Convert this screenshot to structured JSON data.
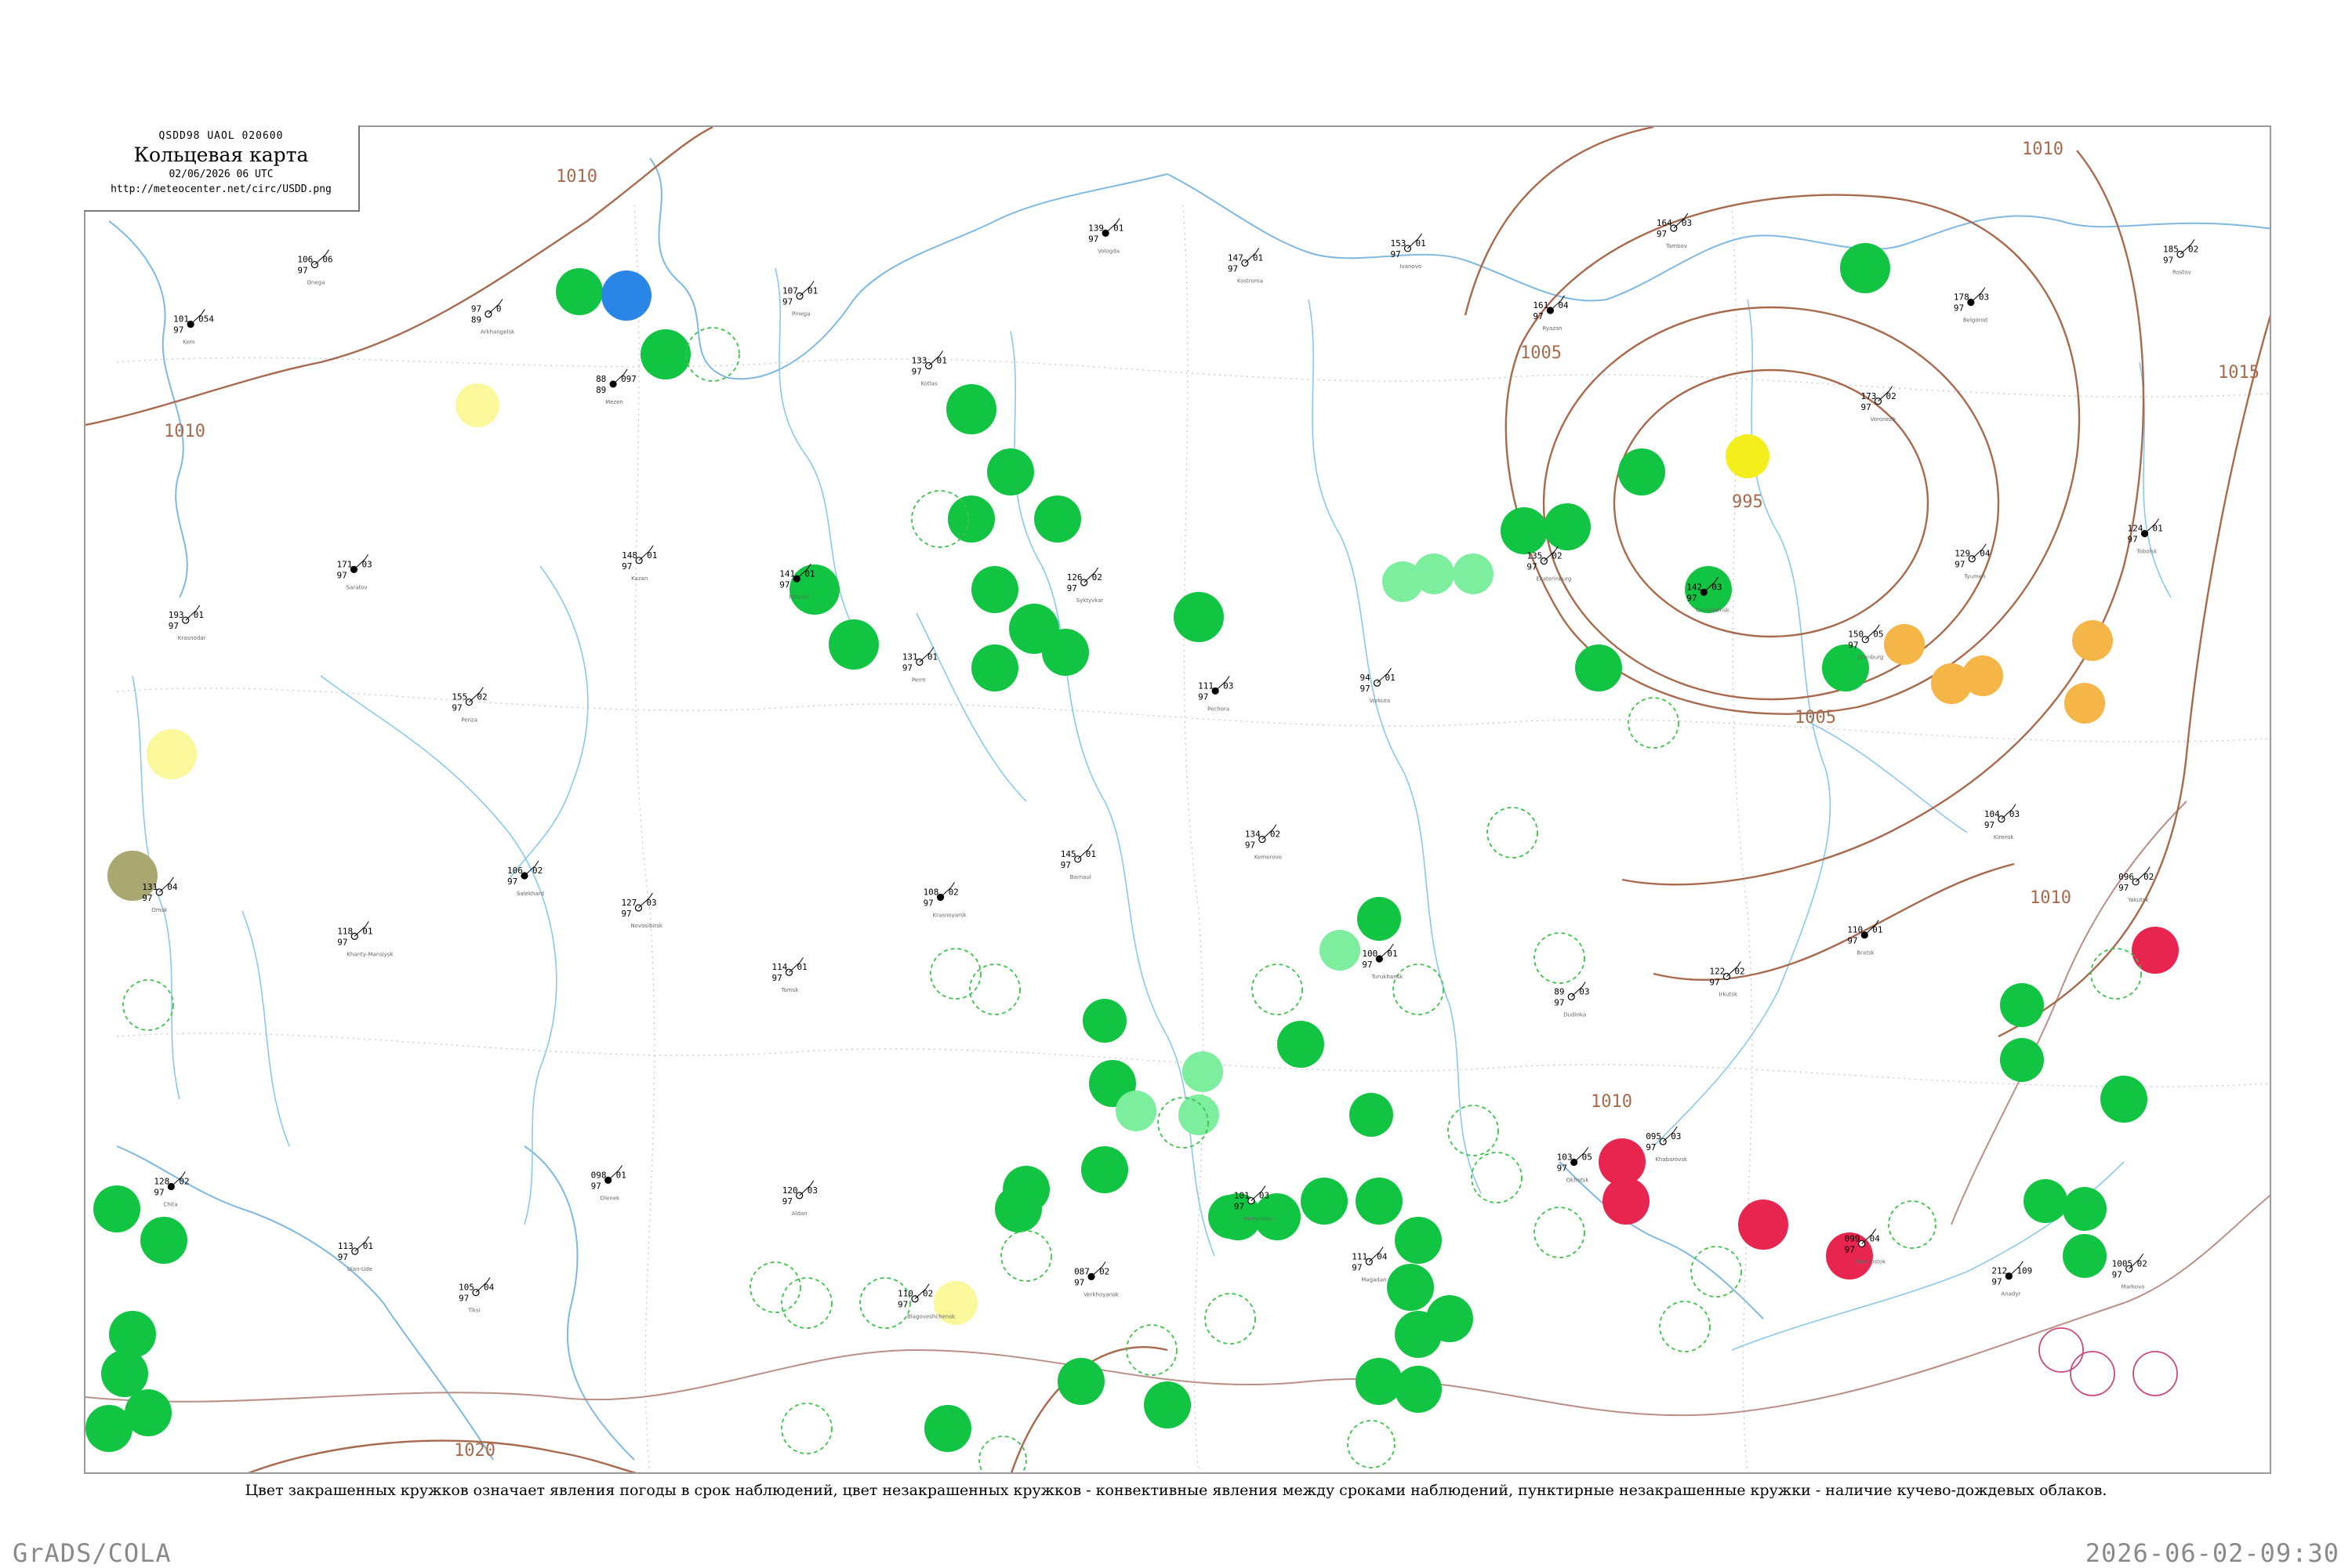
{
  "title_box": {
    "code": "QSDD98  UAOL  020600",
    "title": "Кольцевая карта",
    "date": "02/06/2026 06 UTC",
    "url": "http://meteocenter.net/circ/USDD.png"
  },
  "caption": "Цвет закрашенных кружков означает явления погоды в срок наблюдений, цвет незакрашенных кружков - конвективные явления между сроками наблюдений, пунктирные незакрашенные кружки - наличие кучево-дождевых облаков.",
  "footer": {
    "left": "GrADS/COLA",
    "right": "2026-06-02-09:30"
  },
  "colors": {
    "rain": "#11c442",
    "rain_light": "#7ded9e",
    "snow_shower": "#2a86e6",
    "fog_haze": "#fbf79b",
    "fog_dense": "#f4ee1d",
    "dust": "#a8a870",
    "thunder_shower": "#f5b547",
    "thunderstorm": "#e8254e",
    "cb_dashed": "#3fc24c",
    "convective_ring": "#c94a7a",
    "isobar": "#a86a4e",
    "river": "#8cc8ec"
  },
  "isobar_labels": [
    {
      "text": "1010"
    },
    {
      "text": "1010"
    },
    {
      "text": "1010"
    },
    {
      "text": "1005"
    },
    {
      "text": "1005"
    },
    {
      "text": "995"
    },
    {
      "text": "1015"
    },
    {
      "text": "1020"
    },
    {
      "text": "1010"
    },
    {
      "text": "1010"
    }
  ],
  "stations": [
    {
      "t": "101",
      "p": "054",
      "d": "97",
      "n": "Kem"
    },
    {
      "t": "106",
      "p": "06",
      "d": "97",
      "n": "Onega"
    },
    {
      "t": "97",
      "p": "0",
      "d": "89",
      "n": "Arkhangelsk"
    },
    {
      "t": "88",
      "p": "097",
      "d": "89",
      "n": "Mezen"
    },
    {
      "t": "107",
      "p": "01",
      "d": "97",
      "n": "Pinega"
    },
    {
      "t": "133",
      "p": "01",
      "d": "97",
      "n": "Kotlas"
    },
    {
      "t": "139",
      "p": "01",
      "d": "97",
      "n": "Vologda"
    },
    {
      "t": "147",
      "p": "01",
      "d": "97",
      "n": "Kostroma"
    },
    {
      "t": "153",
      "p": "01",
      "d": "97",
      "n": "Ivanovo"
    },
    {
      "t": "161",
      "p": "04",
      "d": "97",
      "n": "Ryazan"
    },
    {
      "t": "164",
      "p": "03",
      "d": "97",
      "n": "Tambov"
    },
    {
      "t": "173",
      "p": "02",
      "d": "97",
      "n": "Voronezh"
    },
    {
      "t": "178",
      "p": "03",
      "d": "97",
      "n": "Belgorod"
    },
    {
      "t": "185",
      "p": "02",
      "d": "97",
      "n": "Rostov"
    },
    {
      "t": "193",
      "p": "01",
      "d": "97",
      "n": "Krasnodar"
    },
    {
      "t": "171",
      "p": "03",
      "d": "97",
      "n": "Saratov"
    },
    {
      "t": "155",
      "p": "02",
      "d": "97",
      "n": "Penza"
    },
    {
      "t": "148",
      "p": "01",
      "d": "97",
      "n": "Kazan"
    },
    {
      "t": "141",
      "p": "01",
      "d": "97",
      "n": "Izhevsk"
    },
    {
      "t": "131",
      "p": "01",
      "d": "97",
      "n": "Perm"
    },
    {
      "t": "126",
      "p": "02",
      "d": "97",
      "n": "Syktyvkar"
    },
    {
      "t": "111",
      "p": "03",
      "d": "97",
      "n": "Pechora"
    },
    {
      "t": "94",
      "p": "01",
      "d": "97",
      "n": "Vorkuta"
    },
    {
      "t": "135",
      "p": "02",
      "d": "97",
      "n": "Ekaterinburg"
    },
    {
      "t": "142",
      "p": "03",
      "d": "97",
      "n": "Chelyabinsk"
    },
    {
      "t": "150",
      "p": "05",
      "d": "97",
      "n": "Orenburg"
    },
    {
      "t": "129",
      "p": "04",
      "d": "97",
      "n": "Tyumen"
    },
    {
      "t": "124",
      "p": "01",
      "d": "97",
      "n": "Tobolsk"
    },
    {
      "t": "131",
      "p": "04",
      "d": "97",
      "n": "Omsk"
    },
    {
      "t": "118",
      "p": "01",
      "d": "97",
      "n": "Khanty-Mansiysk"
    },
    {
      "t": "106",
      "p": "02",
      "d": "97",
      "n": "Salekhard"
    },
    {
      "t": "127",
      "p": "03",
      "d": "97",
      "n": "Novosibirsk"
    },
    {
      "t": "114",
      "p": "01",
      "d": "97",
      "n": "Tomsk"
    },
    {
      "t": "108",
      "p": "02",
      "d": "97",
      "n": "Krasnoyarsk"
    },
    {
      "t": "145",
      "p": "01",
      "d": "97",
      "n": "Barnaul"
    },
    {
      "t": "134",
      "p": "02",
      "d": "97",
      "n": "Kemerovo"
    },
    {
      "t": "100",
      "p": "01",
      "d": "97",
      "n": "Turukhansk"
    },
    {
      "t": "89",
      "p": "03",
      "d": "97",
      "n": "Dudinka"
    },
    {
      "t": "122",
      "p": "02",
      "d": "97",
      "n": "Irkutsk"
    },
    {
      "t": "110",
      "p": "01",
      "d": "97",
      "n": "Bratsk"
    },
    {
      "t": "104",
      "p": "03",
      "d": "97",
      "n": "Kirensk"
    },
    {
      "t": "096",
      "p": "02",
      "d": "97",
      "n": "Yakutsk"
    },
    {
      "t": "128",
      "p": "02",
      "d": "97",
      "n": "Chita"
    },
    {
      "t": "113",
      "p": "01",
      "d": "97",
      "n": "Ulan-Ude"
    },
    {
      "t": "105",
      "p": "04",
      "d": "97",
      "n": "Tiksi"
    },
    {
      "t": "098",
      "p": "01",
      "d": "97",
      "n": "Olenek"
    },
    {
      "t": "120",
      "p": "03",
      "d": "97",
      "n": "Aldan"
    },
    {
      "t": "110",
      "p": "02",
      "d": "97",
      "n": "Blagoveshchensk"
    },
    {
      "t": "087",
      "p": "02",
      "d": "97",
      "n": "Verkhoyansk"
    },
    {
      "t": "101",
      "p": "03",
      "d": "97",
      "n": "Oymyakon"
    },
    {
      "t": "111",
      "p": "04",
      "d": "97",
      "n": "Magadan"
    },
    {
      "t": "103",
      "p": "05",
      "d": "97",
      "n": "Okhotsk"
    },
    {
      "t": "095",
      "p": "03",
      "d": "97",
      "n": "Khabarovsk"
    },
    {
      "t": "099",
      "p": "04",
      "d": "97",
      "n": "Vladivostok"
    },
    {
      "t": "212",
      "p": "109",
      "d": "97",
      "n": "Anadyr"
    },
    {
      "t": "1005",
      "p": "02",
      "d": "97",
      "n": "Markovo"
    }
  ]
}
